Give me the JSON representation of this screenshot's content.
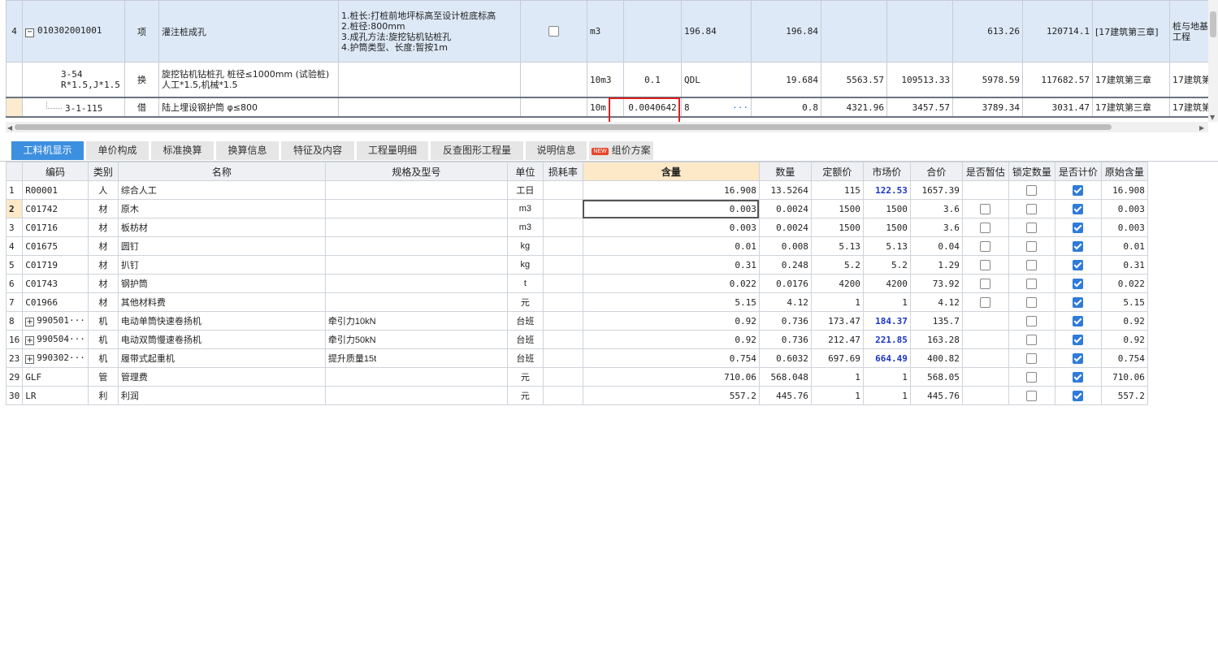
{
  "top_grid": {
    "rows": [
      {
        "no": "4",
        "code": "010302001001",
        "type": "项",
        "name": "灌注桩成孔",
        "features": [
          "1.桩长:打桩前地坪标高至设计桩底标高",
          "2.桩径:800mm",
          "3.成孔方法:旋挖钻机钻桩孔",
          "4.护筒类型、长度:暂按1m"
        ],
        "checked": false,
        "unit": "m3",
        "qty_expr": "",
        "qty_code": "196.84",
        "quantity": "196.84",
        "c1": "",
        "c2": "",
        "price": "613.26",
        "total": "120714.1",
        "chapter": "[17建筑第三章]",
        "major": "桩与地基工程"
      },
      {
        "no": "",
        "code": "3-54",
        "code2": "R*1.5,J*1.5",
        "type": "换",
        "name": "旋挖钻机钻桩孔 桩径≤1000mm (试验桩) 人工*1.5,机械*1.5",
        "unit": "10m3",
        "qty_expr": "0.1",
        "qty_code": "QDL",
        "quantity": "19.684",
        "c1": "5563.57",
        "c2": "109513.33",
        "price": "5978.59",
        "total": "117682.57",
        "chapter": "17建筑第三章",
        "major": "17建筑第"
      },
      {
        "no": "",
        "code": "3-1-115",
        "type": "借",
        "name": "陆上埋设钢护筒 φ≤800",
        "unit": "10m",
        "qty_expr": "0.0040642",
        "qty_code": "8",
        "ellipsis": "···",
        "quantity": "0.8",
        "c1": "4321.96",
        "c2": "3457.57",
        "price": "3789.34",
        "total": "3031.47",
        "chapter": "17建筑第三章",
        "major": "17建筑第"
      }
    ]
  },
  "tabs": [
    {
      "label": "工料机显示",
      "active": true
    },
    {
      "label": "单价构成"
    },
    {
      "label": "标准换算"
    },
    {
      "label": "换算信息"
    },
    {
      "label": "特征及内容"
    },
    {
      "label": "工程量明细"
    },
    {
      "label": "反查图形工程量"
    },
    {
      "label": "说明信息"
    },
    {
      "label": "组价方案",
      "badge": "NEW"
    }
  ],
  "bottom_grid": {
    "headers": [
      "",
      "编码",
      "类别",
      "名称",
      "规格及型号",
      "单位",
      "损耗率",
      "含量",
      "数量",
      "定额价",
      "市场价",
      "合价",
      "是否暂估",
      "锁定数量",
      "是否计价",
      "原始含量"
    ],
    "rows": [
      {
        "no": "1",
        "code": "R00001",
        "type": "人",
        "name": "综合人工",
        "spec": "",
        "unit": "工日",
        "loss": "",
        "content": "16.908",
        "qty": "13.5264",
        "base": "115",
        "market": "122.53",
        "market_hl": true,
        "total": "1657.39",
        "est": null,
        "lock": false,
        "priced": true,
        "orig": "16.908"
      },
      {
        "no": "2",
        "code": "C01742",
        "type": "材",
        "name": "原木",
        "spec": "",
        "unit": "m3",
        "loss": "",
        "content": "0.003",
        "qty": "0.0024",
        "base": "1500",
        "market": "1500",
        "market_hl": false,
        "total": "3.6",
        "est": false,
        "lock": false,
        "priced": true,
        "orig": "0.003",
        "selected": true
      },
      {
        "no": "3",
        "code": "C01716",
        "type": "材",
        "name": "板枋材",
        "spec": "",
        "unit": "m3",
        "loss": "",
        "content": "0.003",
        "qty": "0.0024",
        "base": "1500",
        "market": "1500",
        "market_hl": false,
        "total": "3.6",
        "est": false,
        "lock": false,
        "priced": true,
        "orig": "0.003"
      },
      {
        "no": "4",
        "code": "C01675",
        "type": "材",
        "name": "圆钉",
        "spec": "",
        "unit": "kg",
        "loss": "",
        "content": "0.01",
        "qty": "0.008",
        "base": "5.13",
        "market": "5.13",
        "market_hl": false,
        "total": "0.04",
        "est": false,
        "lock": false,
        "priced": true,
        "orig": "0.01"
      },
      {
        "no": "5",
        "code": "C01719",
        "type": "材",
        "name": "扒钉",
        "spec": "",
        "unit": "kg",
        "loss": "",
        "content": "0.31",
        "qty": "0.248",
        "base": "5.2",
        "market": "5.2",
        "market_hl": false,
        "total": "1.29",
        "est": false,
        "lock": false,
        "priced": true,
        "orig": "0.31"
      },
      {
        "no": "6",
        "code": "C01743",
        "type": "材",
        "name": "钢护筒",
        "spec": "",
        "unit": "t",
        "loss": "",
        "content": "0.022",
        "qty": "0.0176",
        "base": "4200",
        "market": "4200",
        "market_hl": false,
        "total": "73.92",
        "est": false,
        "lock": false,
        "priced": true,
        "orig": "0.022"
      },
      {
        "no": "7",
        "code": "C01966",
        "type": "材",
        "name": "其他材料费",
        "spec": "",
        "unit": "元",
        "loss": "",
        "content": "5.15",
        "qty": "4.12",
        "base": "1",
        "market": "1",
        "market_hl": false,
        "total": "4.12",
        "est": false,
        "lock": false,
        "priced": true,
        "orig": "5.15"
      },
      {
        "no": "8",
        "code": "990501···",
        "expand": true,
        "type": "机",
        "name": "电动单筒快速卷扬机",
        "spec": "牵引力10kN",
        "unit": "台班",
        "loss": "",
        "content": "0.92",
        "qty": "0.736",
        "base": "173.47",
        "market": "184.37",
        "market_hl": true,
        "total": "135.7",
        "est": null,
        "lock": false,
        "priced": true,
        "orig": "0.92"
      },
      {
        "no": "16",
        "code": "990504···",
        "expand": true,
        "type": "机",
        "name": "电动双筒慢速卷扬机",
        "spec": "牵引力50kN",
        "unit": "台班",
        "loss": "",
        "content": "0.92",
        "qty": "0.736",
        "base": "212.47",
        "market": "221.85",
        "market_hl": true,
        "total": "163.28",
        "est": null,
        "lock": false,
        "priced": true,
        "orig": "0.92"
      },
      {
        "no": "23",
        "code": "990302···",
        "expand": true,
        "type": "机",
        "name": "履带式起重机",
        "spec": "提升质量15t",
        "unit": "台班",
        "loss": "",
        "content": "0.754",
        "qty": "0.6032",
        "base": "697.69",
        "market": "664.49",
        "market_hl": true,
        "total": "400.82",
        "est": null,
        "lock": false,
        "priced": true,
        "orig": "0.754"
      },
      {
        "no": "29",
        "code": "GLF",
        "type": "管",
        "name": "管理费",
        "spec": "",
        "unit": "元",
        "loss": "",
        "content": "710.06",
        "qty": "568.048",
        "base": "1",
        "market": "1",
        "market_hl": false,
        "total": "568.05",
        "est": null,
        "lock": false,
        "priced": true,
        "orig": "710.06"
      },
      {
        "no": "30",
        "code": "LR",
        "type": "利",
        "name": "利润",
        "spec": "",
        "unit": "元",
        "loss": "",
        "content": "557.2",
        "qty": "445.76",
        "base": "1",
        "market": "1",
        "market_hl": false,
        "total": "445.76",
        "est": null,
        "lock": false,
        "priced": true,
        "orig": "557.2"
      }
    ]
  }
}
